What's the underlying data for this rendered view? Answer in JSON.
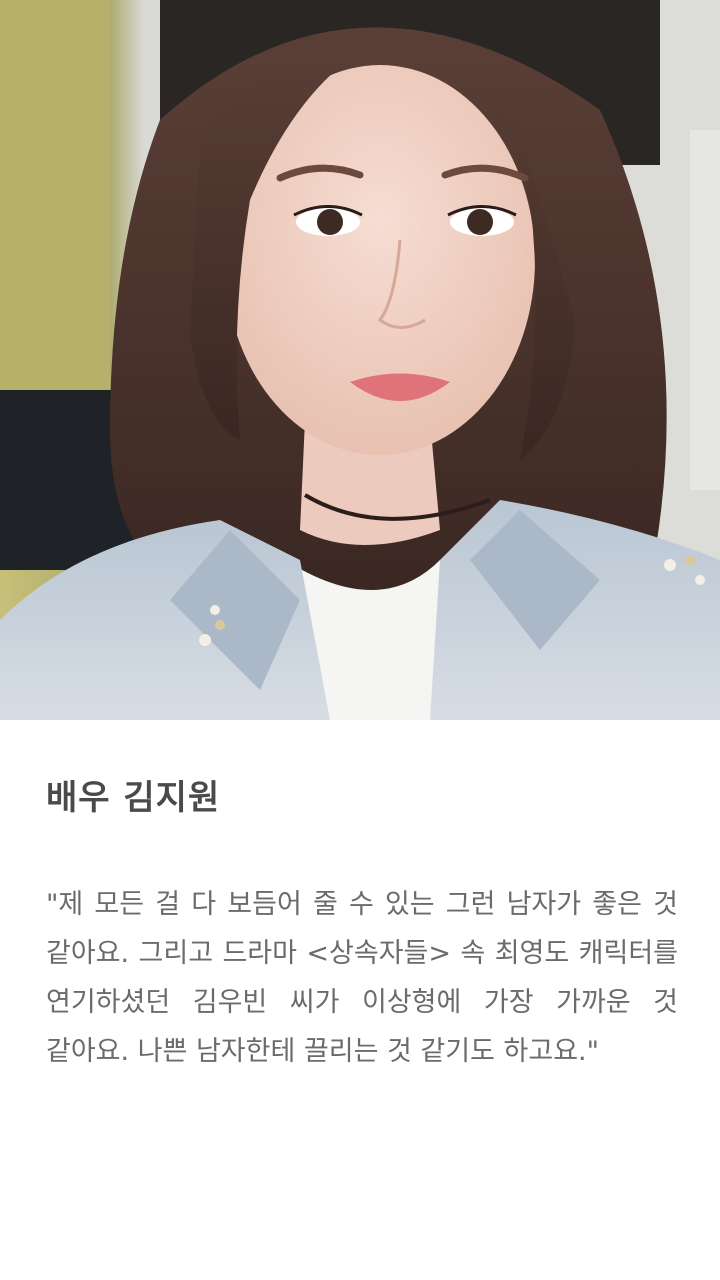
{
  "photo": {
    "subject": "selfie-photo"
  },
  "caption": {
    "title": "배우 김지원",
    "quote": "\"제 모든 걸 다 보듬어 줄 수 있는 그런 남자가 좋은 것 같아요. 그리고 드라마 <상속자들> 속 최영도 캐릭터를 연기하셨던 김우빈 씨가 이상형에 가장 가까운 것 같아요. 나쁜 남자한테 끌리는 것 같기도 하고요.\""
  },
  "colors": {
    "title": "#4a4a4a",
    "body_text": "#6b6b6b",
    "background": "#ffffff"
  }
}
